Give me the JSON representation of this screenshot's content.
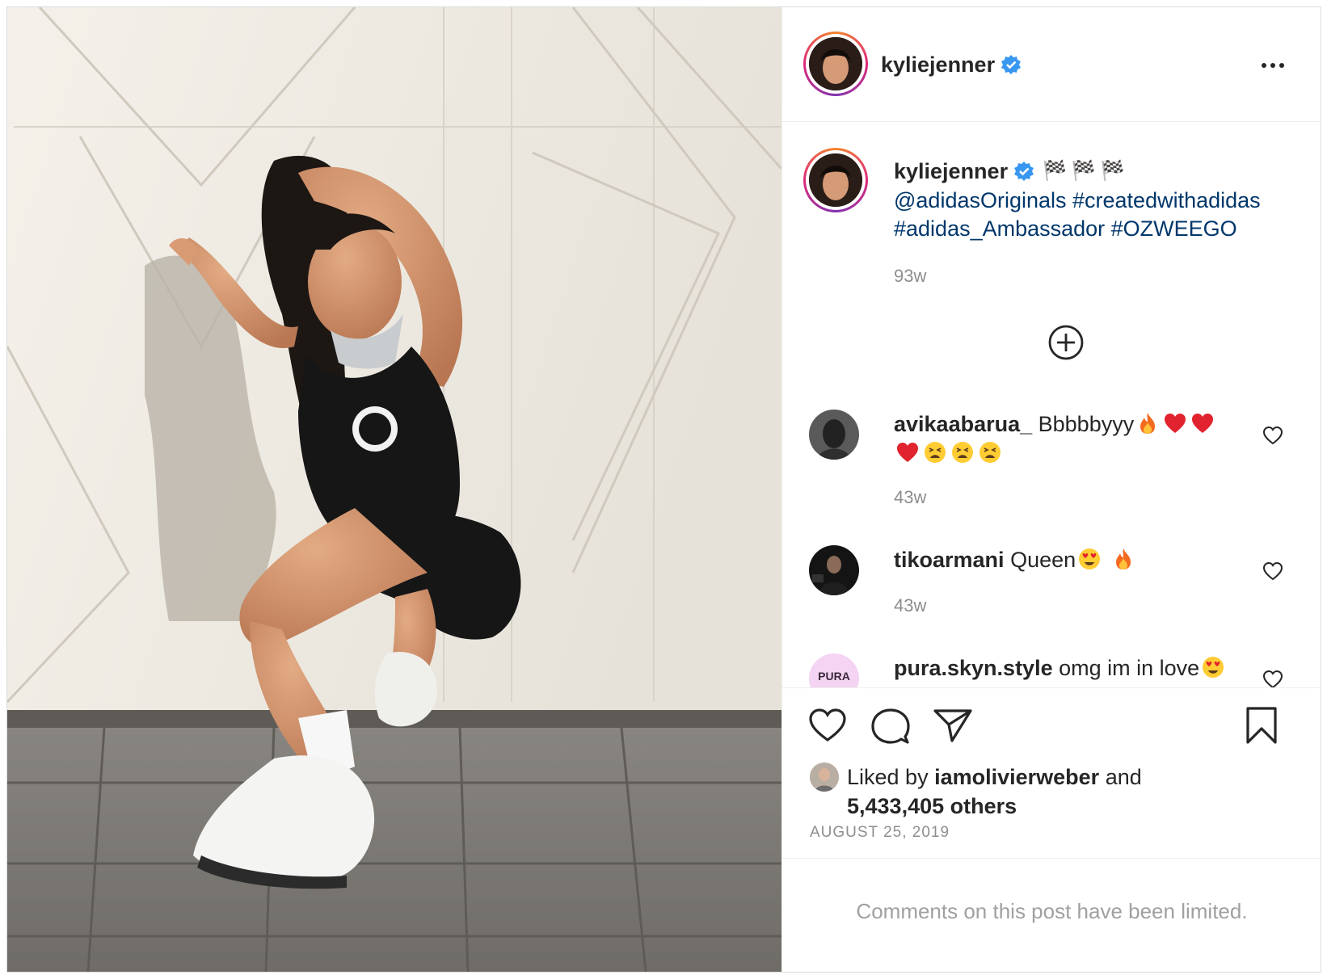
{
  "post": {
    "author": "kyliejenner",
    "header_more_icon": "more-horizontal-icon",
    "caption": {
      "username": "kyliejenner",
      "flags": "🏁🏁🏁",
      "line1": "@adidasOriginals #createdwithadidas",
      "line2": "#adidas_Ambassador #OZWEEGO",
      "time": "93w"
    },
    "load_more_icon": "plus-circle-icon",
    "comments": [
      {
        "username": "avikaabarua_",
        "text": "Bbbbbyyy",
        "time": "43w"
      },
      {
        "username": "tikoarmani",
        "text": "Queen",
        "time": "43w"
      },
      {
        "username": "pura.skyn.style",
        "text": "omg im in love",
        "avatar_text": "PURA"
      }
    ],
    "likes": {
      "prefix": "Liked by ",
      "liker": "iamolivierweber",
      "and": " and",
      "others": "5,433,405 others"
    },
    "date": "AUGUST 25, 2019",
    "comments_limited": "Comments on this post have been limited."
  },
  "colors": {
    "link": "#00376b",
    "muted": "#8e8e8e",
    "verified": "#3897f0",
    "story_ring_start": "#f58529",
    "story_ring_end": "#dd2a7b"
  }
}
